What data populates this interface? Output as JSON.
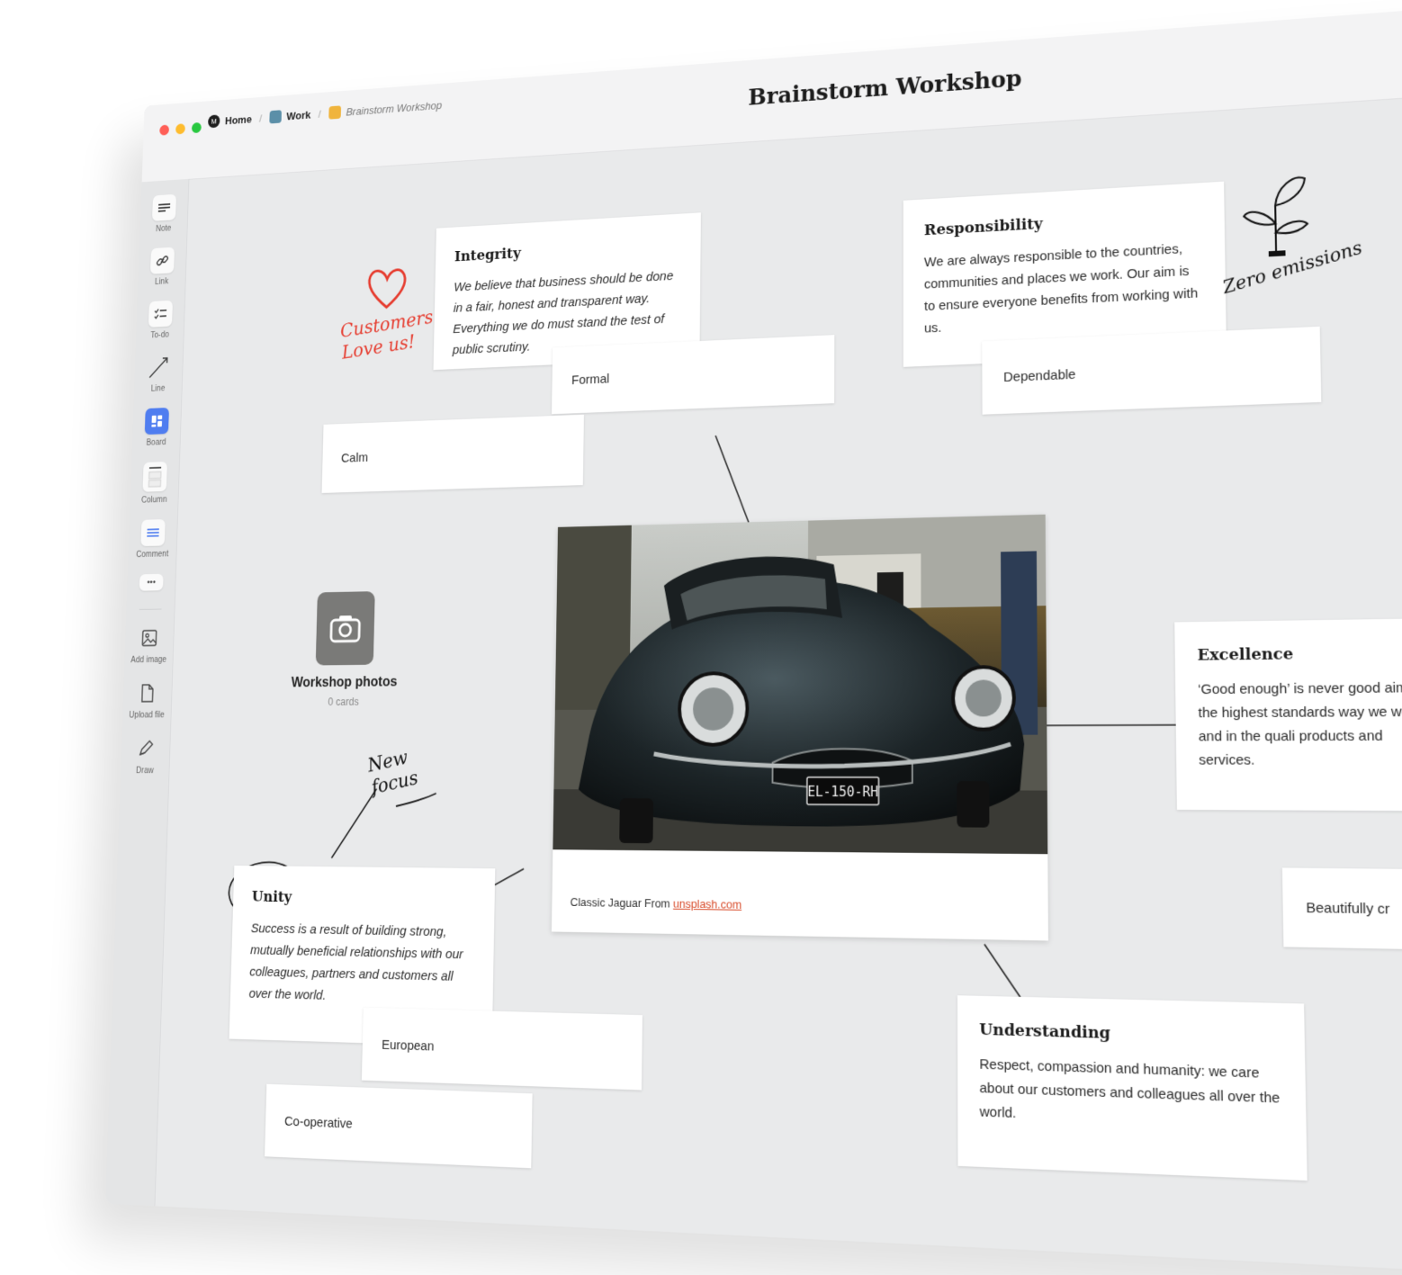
{
  "window": {
    "breadcrumbs": [
      {
        "label": "Home",
        "color": "#1e1e1e"
      },
      {
        "label": "Work",
        "color": "#5b8fa8"
      },
      {
        "label": "Brainstorm Workshop",
        "color": "#f0b43c"
      }
    ],
    "title": "Brainstorm Workshop",
    "traffic_colors": [
      "#ff5f57",
      "#febc2e",
      "#28c840"
    ]
  },
  "toolbar": {
    "items": [
      {
        "label": "Note",
        "icon": "note-icon"
      },
      {
        "label": "Link",
        "icon": "link-icon"
      },
      {
        "label": "To-do",
        "icon": "todo-icon"
      },
      {
        "label": "Line",
        "icon": "line-icon"
      },
      {
        "label": "Board",
        "icon": "board-icon"
      },
      {
        "label": "Column",
        "icon": "column-icon"
      },
      {
        "label": "Comment",
        "icon": "comment-icon"
      }
    ],
    "more": "•••",
    "bottom_items": [
      {
        "label": "Add image",
        "icon": "image-icon"
      },
      {
        "label": "Upload file",
        "icon": "file-icon"
      },
      {
        "label": "Draw",
        "icon": "pencil-icon"
      }
    ]
  },
  "cards": {
    "integrity": {
      "title": "Integrity",
      "body": "We believe that business should be done in a fair, honest and transparent way. Everything we do must stand the test of public scrutiny."
    },
    "responsibility": {
      "title": "Responsibility",
      "body": "We are always responsible to the countries, communities and places we work. Our aim is to ensure everyone benefits from working with us."
    },
    "excellence": {
      "title": "Excellence",
      "body": "‘Good enough’ is never good aim for the highest standards way we work and in the quali products and services."
    },
    "unity": {
      "title": "Unity",
      "body": "Success is a result of building strong, mutually beneficial relationships with our colleagues, partners and customers all over the world."
    },
    "understanding": {
      "title": "Understanding",
      "body": "Respect, compassion and humanity: we care about our customers and colleagues all over the world."
    }
  },
  "chips": {
    "formal": "Formal",
    "calm": "Calm",
    "dependable": "Dependable",
    "beautifully": "Beautifully cr",
    "european": "European",
    "cooperative": "Co-operative"
  },
  "photo": {
    "caption_prefix": "Classic Jaguar From ",
    "caption_link": "unsplash.com",
    "plate": "EL-150-RH"
  },
  "board_tile": {
    "name": "Workshop photos",
    "count": "0 cards"
  },
  "annotations": {
    "customers": "Customers Love us!",
    "zero": "Zero emissions",
    "new_focus": "New focus"
  }
}
